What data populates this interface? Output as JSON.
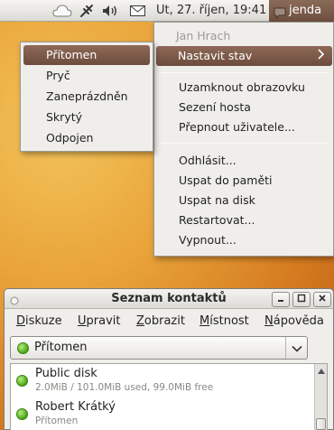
{
  "panel": {
    "clock": "Ut, 27. říjen, 19:41",
    "user_name": "jenda",
    "icons": [
      "weather-cloud-icon",
      "network-icon",
      "volume-icon",
      "mail-icon"
    ]
  },
  "user_menu": {
    "header": "Jan Hrach",
    "items": [
      {
        "label": "Nastavit stav"
      },
      {
        "label": "Uzamknout obrazovku"
      },
      {
        "label": "Sezení hosta"
      },
      {
        "label": "Přepnout uživatele..."
      },
      {
        "label": "Odhlásit..."
      },
      {
        "label": "Uspat do paměti"
      },
      {
        "label": "Uspat na disk"
      },
      {
        "label": "Restartovat..."
      },
      {
        "label": "Vypnout..."
      }
    ]
  },
  "status_submenu": {
    "items": [
      "Přítomen",
      "Pryč",
      "Zaneprázdněn",
      "Skrytý",
      "Odpojen"
    ]
  },
  "contacts_window": {
    "title": "Seznam kontaktů",
    "menubar": [
      {
        "underline": "D",
        "rest": "iskuze"
      },
      {
        "underline": "U",
        "rest": "pravit"
      },
      {
        "underline": "Z",
        "rest": "obrazit"
      },
      {
        "underline": "M",
        "rest": "ístnost"
      },
      {
        "underline": "N",
        "rest": "ápověda"
      }
    ],
    "status_value": "Přítomen",
    "contacts": [
      {
        "name": "Public disk",
        "detail": "2.0MiB / 101.0MiB used, 99.0MiB free"
      },
      {
        "name": "Robert Krátký",
        "detail": "Přítomen"
      }
    ]
  },
  "colors": {
    "accent": "#7a5848",
    "status_online": "#4aa418",
    "wallpaper": "#e9a43a"
  }
}
